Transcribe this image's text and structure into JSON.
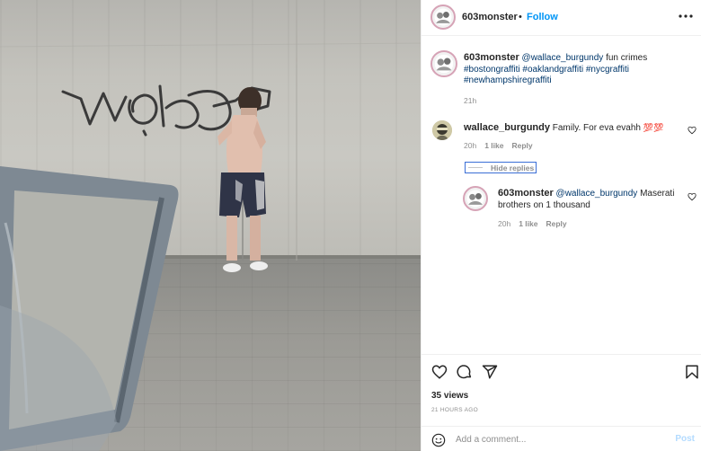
{
  "post": {
    "username": "603monster",
    "follow_label": "Follow",
    "separator": "•",
    "more_icon": "more-dots-icon"
  },
  "caption": {
    "username": "603monster",
    "mention": "@wallace_burgundy",
    "text": " fun crimes",
    "hashtags": [
      "#bostongraffiti",
      "#oaklandgraffiti",
      "#nycgraffiti",
      "#newhampshiregraffiti"
    ],
    "time": "21h"
  },
  "comments": [
    {
      "username": "wallace_burgundy",
      "text": "Family. For eva evahh ",
      "emoji": "💯💯",
      "time": "20h",
      "likes": "1 like",
      "reply_label": "Reply"
    }
  ],
  "hide_replies_label": "Hide replies",
  "replies": [
    {
      "username": "603monster",
      "mention": "@wallace_burgundy",
      "text": " Maserati brothers on 1 thousand",
      "time": "20h",
      "likes": "1 like",
      "reply_label": "Reply"
    }
  ],
  "stats": {
    "views": "35 views",
    "time_ago": "21 HOURS AGO"
  },
  "composer": {
    "placeholder": "Add a comment...",
    "post_label": "Post"
  },
  "icons": {
    "like": "heart-icon",
    "comment": "comment-bubble-icon",
    "share": "paper-plane-icon",
    "save": "bookmark-icon",
    "emoji": "smiley-icon"
  },
  "colors": {
    "link": "#0095f6",
    "mention": "#00376b",
    "muted": "#8e8e8e",
    "post_disabled": "#b3dbff",
    "hide_replies_outline": "#3a6ed6"
  }
}
